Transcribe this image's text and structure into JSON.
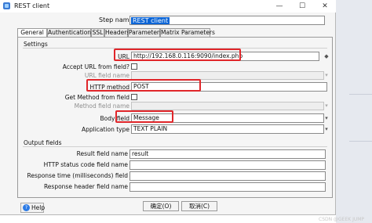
{
  "window": {
    "title": "REST client",
    "minimize_glyph": "—",
    "maximize_glyph": "☐",
    "close_glyph": "✕"
  },
  "step_name": {
    "label": "Step name",
    "value": "REST client"
  },
  "tabs": [
    {
      "label": "General",
      "active": true
    },
    {
      "label": "Authentication"
    },
    {
      "label": "SSL"
    },
    {
      "label": "Headers"
    },
    {
      "label": "Parameters"
    },
    {
      "label": "Matrix Parameters"
    }
  ],
  "settings": {
    "title": "Settings",
    "url_label": "URL",
    "url_value": "http://192.168.0.116:9090/index.php",
    "accept_url_label": "Accept URL from field?",
    "url_field_name_label": "URL field name",
    "http_method_label": "HTTP method",
    "http_method_value": "POST",
    "get_method_label": "Get Method from field",
    "method_field_name_label": "Method field name",
    "body_field_label": "Body field",
    "body_field_value": "Message",
    "application_type_label": "Application type",
    "application_type_value": "TEXT PLAIN"
  },
  "output": {
    "title": "Output fields",
    "result_label": "Result field name",
    "result_value": "result",
    "http_status_label": "HTTP status code field name",
    "response_time_label": "Response time (milliseconds) field",
    "response_header_label": "Response header field name"
  },
  "buttons": {
    "help": "Help",
    "help_icon_glyph": "?",
    "ok": "确定(O)",
    "cancel": "取消(C)"
  },
  "icons": {
    "variable_glyph": "◆",
    "dropdown_glyph": "▾"
  },
  "watermark": "CSDN @GEEK JUMP",
  "colors": {
    "highlight": "#e0262a",
    "selection": "#0a64d6"
  }
}
